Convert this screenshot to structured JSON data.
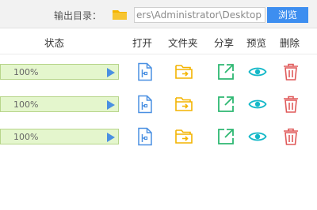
{
  "toolbar": {
    "output_dir_label": "输出目录：",
    "output_path_value": "ers\\Administrator\\Desktop",
    "browse_label": "浏览"
  },
  "table": {
    "headers": {
      "status": "状态",
      "open": "打开",
      "folder": "文件夹",
      "share": "分享",
      "preview": "预览",
      "delete": "删除"
    },
    "rows": [
      {
        "progress_text": "100%",
        "progress": 100
      },
      {
        "progress_text": "100%",
        "progress": 100
      },
      {
        "progress_text": "100%",
        "progress": 100
      }
    ]
  },
  "icons": {
    "output_folder": "folder-icon",
    "play": "play-icon",
    "open": "open-file-icon",
    "folder": "folder-icon",
    "share": "share-icon",
    "preview": "eye-icon",
    "delete": "trash-icon"
  },
  "colors": {
    "accent": "#3d8ef0",
    "folder": "#f4b400",
    "open": "#4a90e2",
    "share": "#2eb872",
    "preview": "#14b8c8",
    "delete": "#e05a5a",
    "progress_fill": "#e4f6cd",
    "progress_border": "#b7d58a"
  }
}
